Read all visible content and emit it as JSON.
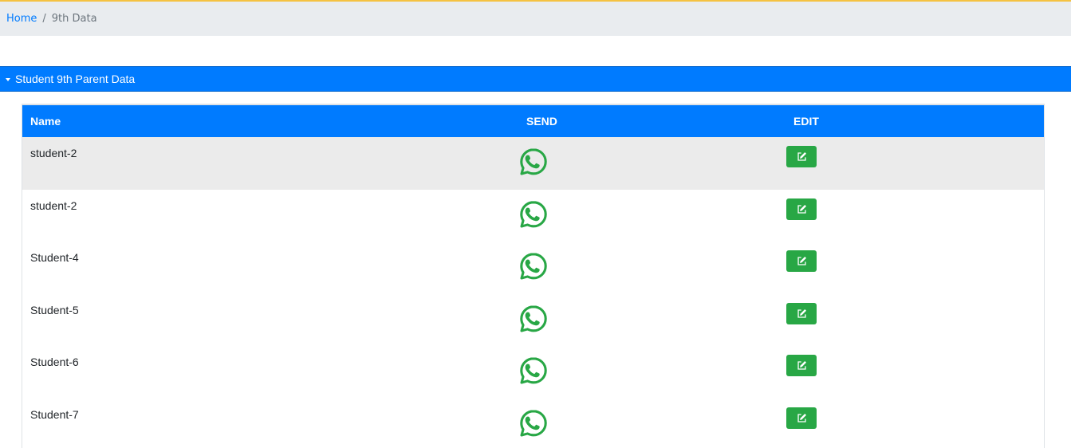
{
  "breadcrumb": {
    "home_label": "Home",
    "separator": "/",
    "current_label": "9th Data"
  },
  "panel": {
    "title": "Student 9th Parent Data"
  },
  "table": {
    "columns": [
      "Name",
      "SEND",
      "EDIT"
    ],
    "rows": [
      {
        "name": "student-2"
      },
      {
        "name": "student-2"
      },
      {
        "name": "Student-4"
      },
      {
        "name": "Student-5"
      },
      {
        "name": "Student-6"
      },
      {
        "name": "Student-7"
      }
    ]
  },
  "icons": {
    "send": "whatsapp-icon",
    "edit": "edit-icon",
    "caret": "caret-down-icon"
  },
  "colors": {
    "primary": "#007bff",
    "success": "#28a745",
    "whatsapp": "#28a745",
    "breadcrumb_bg": "#e9ecef",
    "accent_strip": "#f5c242"
  }
}
